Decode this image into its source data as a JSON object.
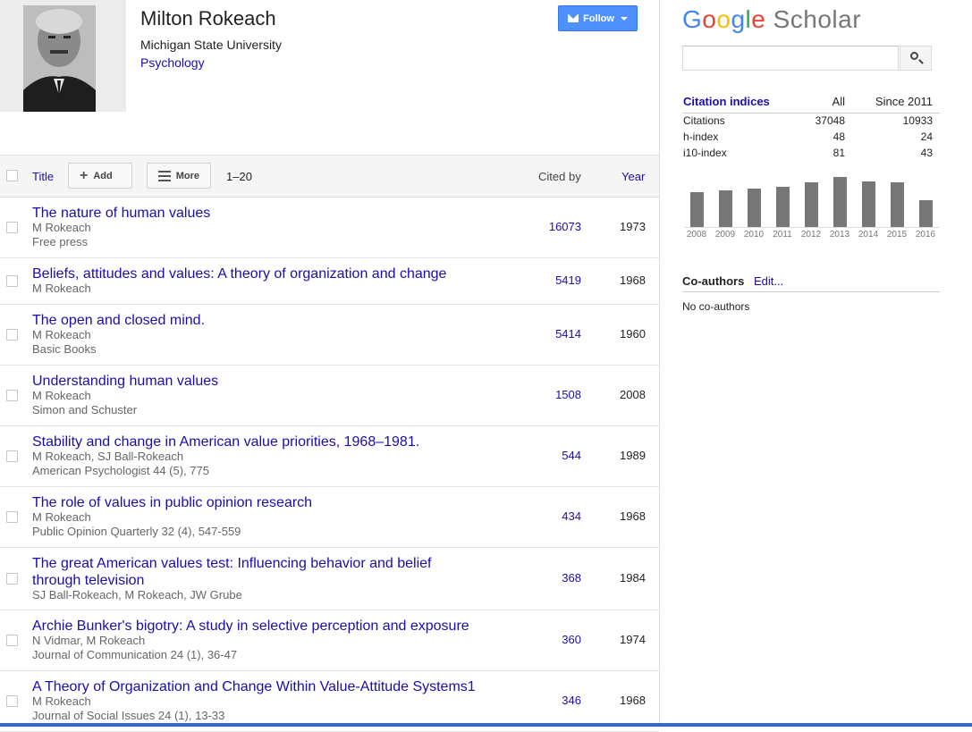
{
  "profile": {
    "name": "Milton Rokeach",
    "affiliation": "Michigan State University",
    "field": "Psychology",
    "follow_label": "Follow"
  },
  "toolbar": {
    "title_label": "Title",
    "add_label": "Add",
    "more_label": "More",
    "range": "1–20",
    "cited_by_label": "Cited by",
    "year_label": "Year"
  },
  "articles": [
    {
      "title": "The nature of human values",
      "authors": "M Rokeach",
      "venue": "Free press",
      "cited": "16073",
      "year": "1973"
    },
    {
      "title": "Beliefs, attitudes and values: A theory of organization and change",
      "authors": "M Rokeach",
      "venue": "",
      "cited": "5419",
      "year": "1968"
    },
    {
      "title": "The open and closed mind.",
      "authors": "M Rokeach",
      "venue": "Basic Books",
      "cited": "5414",
      "year": "1960"
    },
    {
      "title": "Understanding human values",
      "authors": "M Rokeach",
      "venue": "Simon and Schuster",
      "cited": "1508",
      "year": "2008"
    },
    {
      "title": "Stability and change in American value priorities, 1968–1981.",
      "authors": "M Rokeach, SJ Ball-Rokeach",
      "venue": "American Psychologist 44 (5), 775",
      "cited": "544",
      "year": "1989"
    },
    {
      "title": "The role of values in public opinion research",
      "authors": "M Rokeach",
      "venue": "Public Opinion Quarterly 32 (4), 547-559",
      "cited": "434",
      "year": "1968"
    },
    {
      "title": "The great American values test: Influencing behavior and belief through television",
      "authors": "SJ Ball-Rokeach, M Rokeach, JW Grube",
      "venue": "",
      "cited": "368",
      "year": "1984"
    },
    {
      "title": "Archie Bunker's bigotry: A study in selective perception and exposure",
      "authors": "N Vidmar, M Rokeach",
      "venue": "Journal of Communication 24 (1), 36-47",
      "cited": "360",
      "year": "1974"
    },
    {
      "title": "A Theory of Organization and Change Within Value-Attitude Systems1",
      "authors": "M Rokeach",
      "venue": "Journal of Social Issues 24 (1), 13-33",
      "cited": "346",
      "year": "1968"
    }
  ],
  "sidebar": {
    "logo_google": "Google",
    "logo_scholar": "Scholar",
    "search_value": "",
    "citation_indices": {
      "heading": "Citation indices",
      "col_all": "All",
      "col_since": "Since 2011",
      "rows": [
        {
          "label": "Citations",
          "all": "37048",
          "since": "10933"
        },
        {
          "label": "h-index",
          "all": "48",
          "since": "24"
        },
        {
          "label": "i10-index",
          "all": "81",
          "since": "43"
        }
      ]
    },
    "coauthors_label": "Co-authors",
    "coauthors_edit": "Edit...",
    "no_coauthors": "No co-authors"
  },
  "colors": {
    "link": "#1a0dab",
    "follow_button": "#4d90fe",
    "chart_bar": "#777777",
    "bottom_accent": "#3367d6"
  },
  "chart_data": {
    "type": "bar",
    "categories": [
      "2008",
      "2009",
      "2010",
      "2011",
      "2012",
      "2013",
      "2014",
      "2015",
      "2016"
    ],
    "values": [
      1000,
      1035,
      1085,
      1140,
      1260,
      1420,
      1290,
      1265,
      760
    ]
  }
}
